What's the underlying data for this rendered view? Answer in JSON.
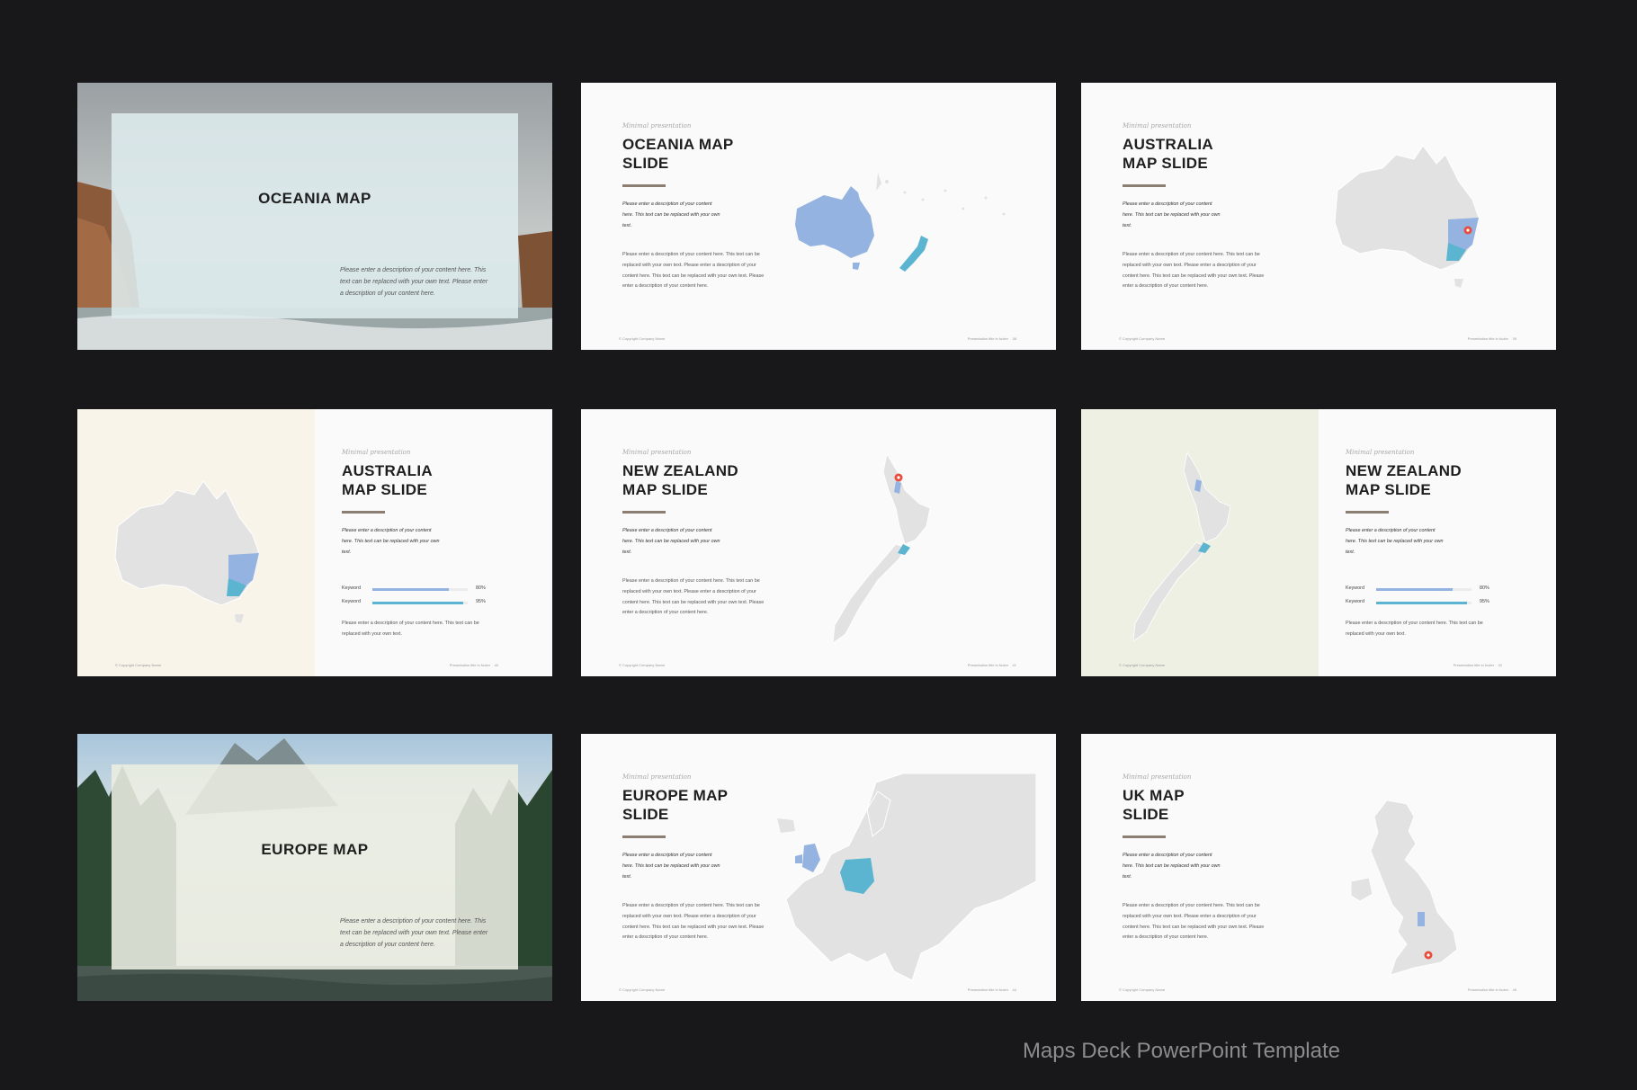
{
  "brand": {
    "accent_blue": "#94b3e0",
    "accent_teal": "#5bb4d0",
    "rule_brown": "#8b7e72",
    "pin_red": "#e74c3c",
    "land_gray": "#e2e2e2"
  },
  "caption": "Maps Deck PowerPoint Template",
  "common": {
    "eyebrow": "Minimal presentation",
    "desc_italic": "Please enter a description of your content here. This text can be replaced with your own text.",
    "desc_body": "Please enter a description of your content here. This text can be replaced with your own text. Please enter a description of your content here. This text can be replaced with your own text. Please enter a description of your content here.",
    "desc_short": "Please enter a description of your content here. This text can be replaced with your own text.",
    "footer_left": "© Copyright Company Name",
    "footer_right": "Presentation title in footer",
    "cover_desc": "Please enter a description of your content here. This text can be replaced with your own text. Please enter a description of your content here.",
    "keywords": [
      {
        "label": "Keyword",
        "percent_text": "80%",
        "value": 0.8
      },
      {
        "label": "Keyword",
        "percent_text": "95%",
        "value": 0.95
      }
    ]
  },
  "slides": {
    "s1": {
      "title": "OCEANIA MAP"
    },
    "s2": {
      "title_l1": "OCEANIA MAP",
      "title_l2": "SLIDE",
      "page": "38"
    },
    "s3": {
      "title_l1": "AUSTRALIA",
      "title_l2": "MAP SLIDE",
      "page": "39"
    },
    "s4": {
      "title_l1": "AUSTRALIA",
      "title_l2": "MAP SLIDE",
      "page": "40"
    },
    "s5": {
      "title_l1": "NEW ZEALAND",
      "title_l2": "MAP SLIDE",
      "page": "41"
    },
    "s6": {
      "title_l1": "NEW ZEALAND",
      "title_l2": "MAP SLIDE",
      "page": "42"
    },
    "s7": {
      "title": "EUROPE MAP"
    },
    "s8": {
      "title_l1": "EUROPE MAP",
      "title_l2": "SLIDE",
      "page": "44"
    },
    "s9": {
      "title_l1": "UK MAP",
      "title_l2": "SLIDE",
      "page": "45"
    }
  }
}
